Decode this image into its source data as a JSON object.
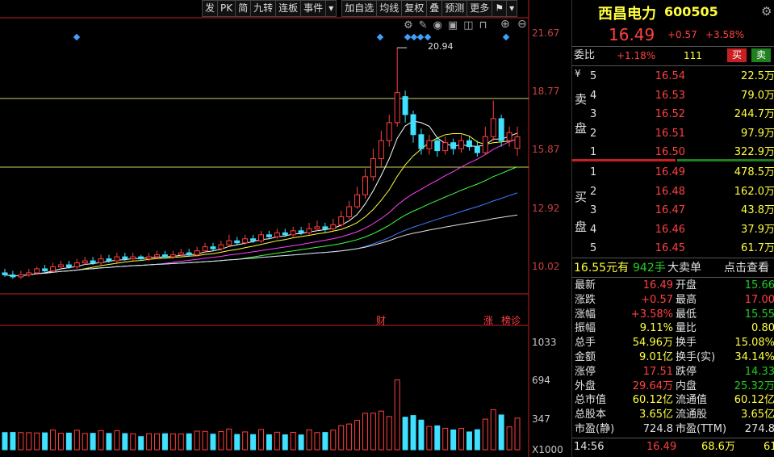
{
  "toolbar": {
    "buttons": [
      "发",
      "PK",
      "简",
      "九转",
      "连板",
      "事件"
    ],
    "buttons2": [
      "加自选",
      "均线",
      "复权",
      "叠",
      "预测",
      "更多"
    ]
  },
  "price_axis": [
    "21.67",
    "18.77",
    "15.87",
    "12.92",
    "10.02"
  ],
  "volume_axis": [
    "1033",
    "694",
    "347",
    "X1000"
  ],
  "chart_marks": {
    "peak_label": "20.94",
    "fin_tag": "财",
    "zhang_tag": "涨",
    "bang_tag": "榜诊"
  },
  "header": {
    "name": "西昌电力",
    "code": "600505",
    "price": "16.49",
    "change": "+0.57",
    "pct": "+3.58%"
  },
  "weibi": {
    "label": "委比",
    "value": "+1.18%",
    "num": "111",
    "sell_btn": "买",
    "buy_btn": "卖"
  },
  "sell_label": {
    "c1": "¥",
    "c2": "卖",
    "c3": "盘"
  },
  "buy_label": {
    "c1": "买",
    "c2": "盘"
  },
  "sells": [
    {
      "idx": "5",
      "price": "16.54",
      "vol": "22.5万"
    },
    {
      "idx": "4",
      "price": "16.53",
      "vol": "79.0万"
    },
    {
      "idx": "3",
      "price": "16.52",
      "vol": "244.7万"
    },
    {
      "idx": "2",
      "price": "16.51",
      "vol": "97.9万"
    },
    {
      "idx": "1",
      "price": "16.50",
      "vol": "322.9万"
    }
  ],
  "buys": [
    {
      "idx": "1",
      "price": "16.49",
      "vol": "478.5万"
    },
    {
      "idx": "2",
      "price": "16.48",
      "vol": "162.0万"
    },
    {
      "idx": "3",
      "price": "16.47",
      "vol": "43.8万"
    },
    {
      "idx": "4",
      "price": "16.46",
      "vol": "37.9万"
    },
    {
      "idx": "5",
      "price": "16.45",
      "vol": "61.7万"
    }
  ],
  "bigorder": {
    "price": "16.55元有",
    "qty": "942手",
    "txt": "大卖单",
    "link": "点击查看"
  },
  "stats": [
    {
      "l1": "最新",
      "v1": "16.49",
      "l2": "开盘",
      "v2": "15.66"
    },
    {
      "l1": "涨跌",
      "v1": "+0.57",
      "l2": "最高",
      "v2": "17.00"
    },
    {
      "l1": "涨幅",
      "v1": "+3.58%",
      "l2": "最低",
      "v2": "15.55"
    },
    {
      "l1": "振幅",
      "v1": "9.11%",
      "l2": "量比",
      "v2": "0.80"
    },
    {
      "l1": "总手",
      "v1": "54.96万",
      "l2": "换手",
      "v2": "15.08%"
    },
    {
      "l1": "金额",
      "v1": "9.01亿",
      "l2": "换手(实)",
      "v2": "34.14%"
    },
    {
      "l1": "涨停",
      "v1": "17.51",
      "l2": "跌停",
      "v2": "14.33"
    },
    {
      "l1": "外盘",
      "v1": "29.64万",
      "l2": "内盘",
      "v2": "25.32万"
    },
    {
      "l1": "总市值",
      "v1": "60.12亿",
      "l2": "流通值",
      "v2": "60.12亿"
    },
    {
      "l1": "总股本",
      "v1": "3.65亿",
      "l2": "流通股",
      "v2": "3.65亿"
    },
    {
      "l1": "市盈(静)",
      "v1": "724.8",
      "l2": "市盈(TTM)",
      "v2": "274.8"
    }
  ],
  "tick": {
    "time": "14:56",
    "price": "16.49",
    "vol": "68.6万",
    "n": "61"
  },
  "colors": {
    "up": "#ff4040",
    "down": "#40e0ff",
    "ma5": "#ffffff",
    "ma10": "#ffff40",
    "ma20": "#ff40ff",
    "ma30": "#40ff40",
    "ma60": "#4080ff",
    "ma120": "#e0e0e0"
  },
  "chart_data": {
    "type": "candlestick",
    "y_axis_ticks": [
      21.67,
      18.77,
      15.87,
      12.92,
      10.02
    ],
    "volume_axis_ticks": [
      1033,
      694,
      347
    ],
    "volume_unit": "X1000",
    "candles": [
      [
        9.7,
        9.6,
        9.9,
        9.5
      ],
      [
        9.6,
        9.5,
        9.8,
        9.4
      ],
      [
        9.5,
        9.6,
        9.8,
        9.4
      ],
      [
        9.6,
        9.7,
        9.9,
        9.5
      ],
      [
        9.7,
        9.9,
        10.0,
        9.6
      ],
      [
        9.9,
        9.8,
        10.1,
        9.7
      ],
      [
        9.8,
        10.0,
        10.2,
        9.7
      ],
      [
        10.0,
        10.1,
        10.3,
        9.9
      ],
      [
        10.1,
        10.0,
        10.3,
        9.9
      ],
      [
        10.0,
        10.2,
        10.4,
        9.9
      ],
      [
        10.2,
        10.3,
        10.5,
        10.1
      ],
      [
        10.3,
        10.2,
        10.5,
        10.1
      ],
      [
        10.2,
        10.4,
        10.6,
        10.1
      ],
      [
        10.4,
        10.3,
        10.6,
        10.2
      ],
      [
        10.3,
        10.5,
        10.7,
        10.2
      ],
      [
        10.5,
        10.4,
        10.7,
        10.3
      ],
      [
        10.4,
        10.5,
        10.7,
        10.3
      ],
      [
        10.5,
        10.4,
        10.6,
        10.3
      ],
      [
        10.4,
        10.5,
        10.7,
        10.3
      ],
      [
        10.5,
        10.6,
        10.8,
        10.4
      ],
      [
        10.6,
        10.5,
        10.8,
        10.4
      ],
      [
        10.5,
        10.6,
        10.8,
        10.4
      ],
      [
        10.6,
        10.7,
        10.9,
        10.5
      ],
      [
        10.7,
        10.6,
        10.9,
        10.5
      ],
      [
        10.6,
        10.8,
        11.0,
        10.5
      ],
      [
        10.8,
        11.0,
        11.2,
        10.7
      ],
      [
        11.0,
        10.9,
        11.2,
        10.8
      ],
      [
        10.9,
        11.1,
        11.3,
        10.8
      ],
      [
        11.1,
        11.3,
        11.6,
        11.0
      ],
      [
        11.3,
        11.2,
        11.5,
        11.1
      ],
      [
        11.2,
        11.4,
        11.6,
        11.1
      ],
      [
        11.4,
        11.3,
        11.6,
        11.2
      ],
      [
        11.3,
        11.6,
        11.8,
        11.2
      ],
      [
        11.6,
        11.5,
        11.8,
        11.4
      ],
      [
        11.5,
        11.7,
        11.9,
        11.4
      ],
      [
        11.7,
        11.6,
        11.9,
        11.5
      ],
      [
        11.6,
        11.8,
        12.0,
        11.5
      ],
      [
        11.8,
        11.7,
        12.0,
        11.6
      ],
      [
        11.7,
        11.9,
        12.2,
        11.6
      ],
      [
        11.9,
        12.0,
        12.3,
        11.8
      ],
      [
        12.0,
        11.9,
        12.2,
        11.7
      ],
      [
        11.9,
        12.1,
        12.4,
        11.8
      ],
      [
        12.1,
        12.5,
        12.8,
        12.0
      ],
      [
        12.5,
        13.0,
        13.3,
        12.4
      ],
      [
        13.0,
        13.6,
        14.0,
        12.9
      ],
      [
        13.6,
        14.5,
        14.9,
        13.4
      ],
      [
        14.5,
        15.4,
        15.9,
        14.3
      ],
      [
        15.4,
        16.3,
        16.8,
        15.0
      ],
      [
        16.3,
        17.2,
        17.6,
        16.0
      ],
      [
        17.2,
        18.7,
        20.94,
        17.0
      ],
      [
        18.5,
        17.6,
        18.8,
        17.2
      ],
      [
        17.6,
        16.6,
        17.8,
        16.2
      ],
      [
        16.6,
        15.9,
        16.9,
        15.6
      ],
      [
        15.9,
        16.3,
        16.6,
        15.6
      ],
      [
        16.3,
        15.8,
        16.5,
        15.5
      ],
      [
        15.8,
        16.2,
        16.5,
        15.6
      ],
      [
        16.2,
        15.9,
        16.4,
        15.6
      ],
      [
        15.9,
        16.3,
        16.6,
        15.7
      ],
      [
        16.3,
        16.0,
        16.5,
        15.8
      ],
      [
        16.0,
        15.7,
        16.3,
        15.5
      ],
      [
        15.7,
        16.5,
        17.0,
        15.6
      ],
      [
        16.5,
        17.4,
        18.3,
        16.3
      ],
      [
        17.4,
        16.3,
        17.6,
        16.0
      ],
      [
        16.3,
        16.7,
        17.0,
        16.0
      ],
      [
        15.92,
        16.49,
        17.0,
        15.55
      ]
    ]
  }
}
